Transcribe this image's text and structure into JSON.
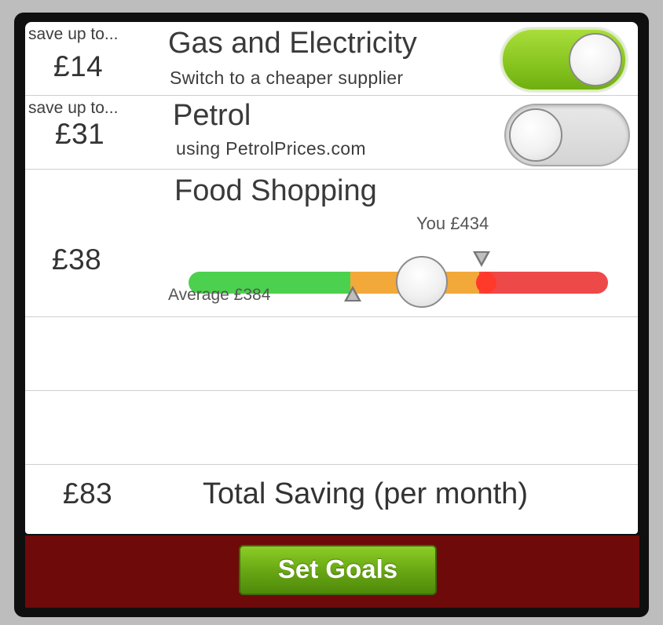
{
  "rows": {
    "gas": {
      "save_prefix": "save up to...",
      "amount": "£14",
      "title": "Gas and Electricity",
      "subtitle": "Switch to a cheaper supplier",
      "toggle_on": true
    },
    "petrol": {
      "save_prefix": "save up to...",
      "amount": "£31",
      "title": "Petrol",
      "subtitle": "using PetrolPrices.com",
      "toggle_on": false
    },
    "food": {
      "amount": "£38",
      "title": "Food Shopping",
      "you_label": "You £434",
      "average_label": "Average £384"
    }
  },
  "total": {
    "amount": "£83",
    "label": "Total Saving (per month)"
  },
  "footer": {
    "set_goals_label": "Set Goals"
  },
  "colors": {
    "toggle_on": "#86c41e",
    "slider_green": "#4cd14e",
    "slider_orange": "#f3a83a",
    "slider_red": "#ee4949",
    "footer_bg": "#6e0a0a",
    "button_green": "#6aa814"
  }
}
